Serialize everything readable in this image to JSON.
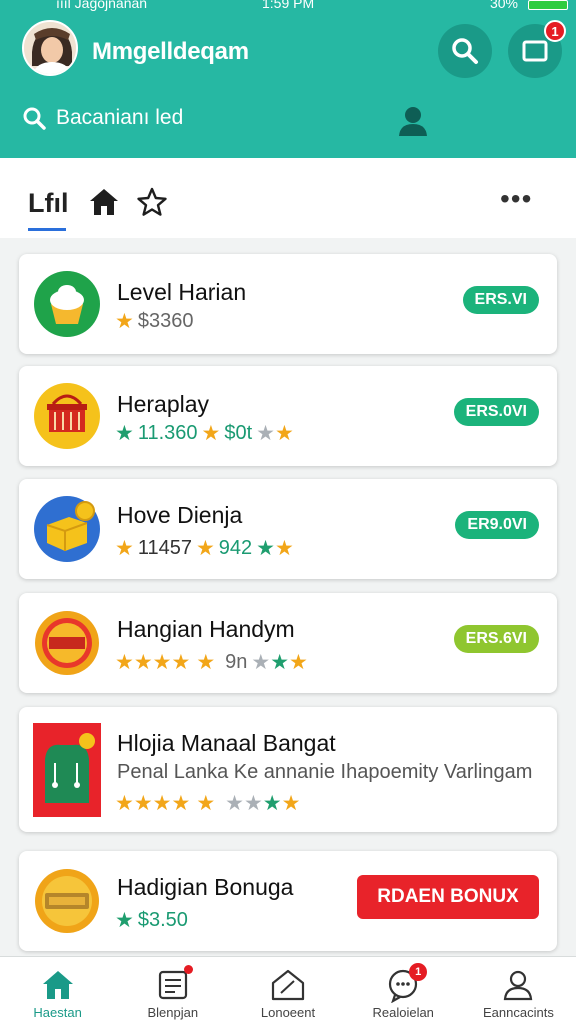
{
  "status_bar": {
    "carrier": "ıııl Jagojnanan",
    "time": "1:59 PM",
    "battery": "30%"
  },
  "header": {
    "title": "Mmgelldeqam",
    "search_placeholder": "Bacanianı led",
    "notification_count": "1",
    "color": "#26b8a3"
  },
  "tabs": {
    "first_label": "Lfıl",
    "icons": [
      "home-icon",
      "star-icon"
    ]
  },
  "cards": [
    {
      "title": "Level Harian",
      "rating_text": "$3360",
      "badge": "ERS.VI",
      "badge_color": "#1bb37b",
      "icon": "cupcake-icon"
    },
    {
      "title": "Heraplay",
      "rating_text": "11.360",
      "rating_text2": "$0t",
      "badge": "ERS.0VI",
      "badge_color": "#1bb37b",
      "icon": "basket-icon"
    },
    {
      "title": "Hove Dienja",
      "rating_text": "11457",
      "rating_text2": "942",
      "badge": "ER9.0VI",
      "badge_color": "#1bb37b",
      "icon": "treasure-box-icon"
    },
    {
      "title": "Hangian Handym",
      "rating_text": "9n",
      "badge": "ERS.6VI",
      "badge_color": "#8fc62f",
      "icon": "gold-coin-icon"
    },
    {
      "title": "Hlojia Manaal Bangat",
      "subtitle": "Penal Lanka Ke annanie Ihapoemity Varlingam",
      "icon": "gift-bag-icon"
    },
    {
      "title": "Hadigian Bonuga",
      "rating_text": "$3.50",
      "button": "RDAEN BONUX",
      "icon": "gold-coin-icon"
    }
  ],
  "bottom_nav": [
    {
      "label": "Haestan",
      "icon": "home-icon",
      "active": true
    },
    {
      "label": "Blenpjan",
      "icon": "list-icon",
      "dot": true
    },
    {
      "label": "Lonoeent",
      "icon": "chart-icon"
    },
    {
      "label": "Realoielan",
      "icon": "chat-icon",
      "badge": "1"
    },
    {
      "label": "Eanncacints",
      "icon": "profile-icon"
    }
  ]
}
